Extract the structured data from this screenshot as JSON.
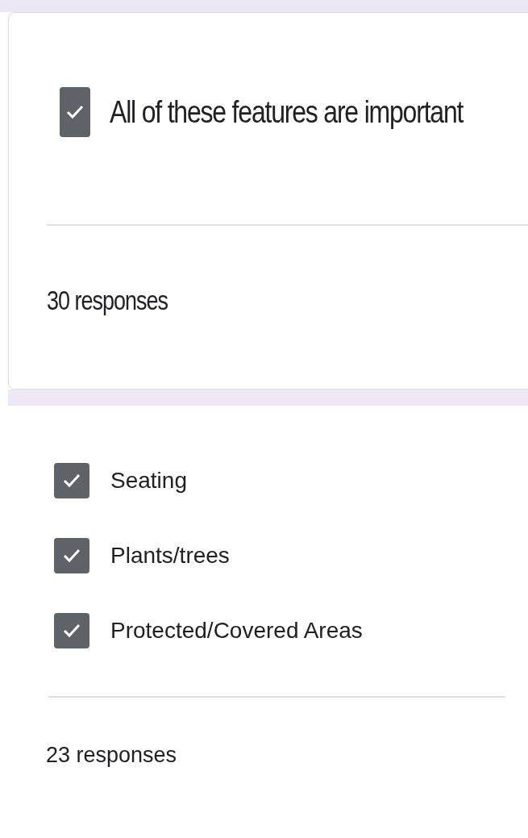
{
  "sections": [
    {
      "kind": "card",
      "options": [
        {
          "label": "All of these features are important",
          "checked": true
        }
      ],
      "responses": "30 responses"
    },
    {
      "kind": "plain",
      "options": [
        {
          "label": "Seating",
          "checked": true
        },
        {
          "label": "Plants/trees",
          "checked": true
        },
        {
          "label": "Protected/Covered Areas",
          "checked": true
        }
      ],
      "responses": "23 responses"
    }
  ]
}
